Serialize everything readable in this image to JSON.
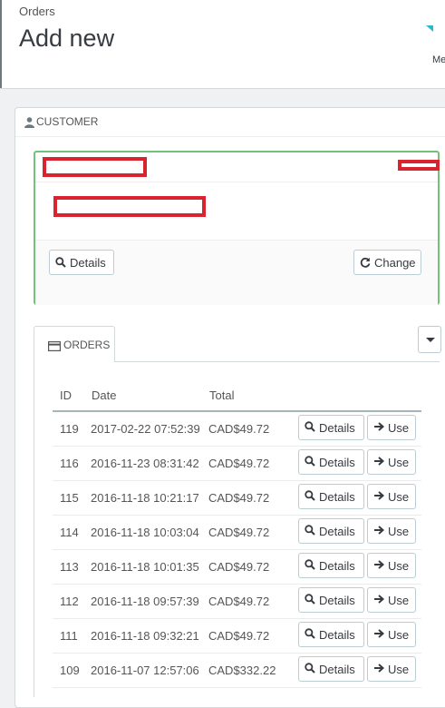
{
  "header": {
    "breadcrumb": "Orders",
    "title": "Add new",
    "toolbar_label": "Me"
  },
  "customer_panel": {
    "heading": "CUSTOMER",
    "details_label": "Details",
    "change_label": "Change",
    "accent_color": "#72c279",
    "redaction_color": "#d9232e"
  },
  "orders": {
    "tab_label": "ORDERS",
    "columns": [
      "ID",
      "Date",
      "Total"
    ],
    "details_label": "Details",
    "use_label": "Use",
    "rows": [
      {
        "id": "119",
        "date": "2017-02-22 07:52:39",
        "total": "CAD$49.72"
      },
      {
        "id": "116",
        "date": "2016-11-23 08:31:42",
        "total": "CAD$49.72"
      },
      {
        "id": "115",
        "date": "2016-11-18 10:21:17",
        "total": "CAD$49.72"
      },
      {
        "id": "114",
        "date": "2016-11-18 10:03:04",
        "total": "CAD$49.72"
      },
      {
        "id": "113",
        "date": "2016-11-18 10:01:35",
        "total": "CAD$49.72"
      },
      {
        "id": "112",
        "date": "2016-11-18 09:57:39",
        "total": "CAD$49.72"
      },
      {
        "id": "111",
        "date": "2016-11-18 09:32:21",
        "total": "CAD$49.72"
      },
      {
        "id": "109",
        "date": "2016-11-07 12:57:06",
        "total": "CAD$332.22"
      }
    ]
  },
  "icons": {
    "heading": "user-icon",
    "details": "search-icon",
    "change": "refresh-icon",
    "orders_tab": "credit-card-icon",
    "use": "arrow-right-icon",
    "dropdown": "caret-down-icon"
  }
}
